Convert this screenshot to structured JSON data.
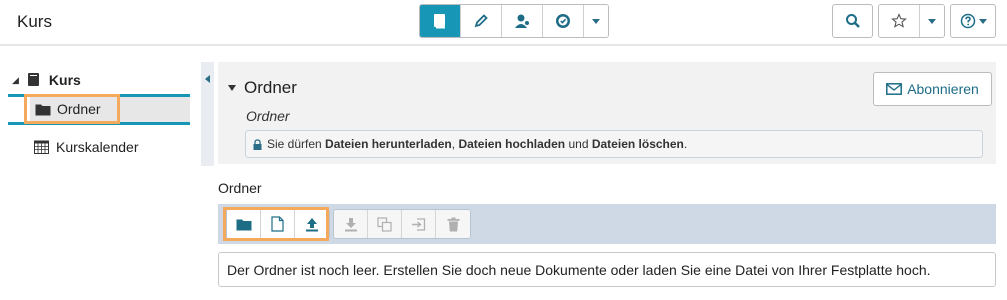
{
  "header": {
    "course_title": "Kurs",
    "tools": [
      {
        "name": "book-icon",
        "active": true
      },
      {
        "name": "pencil-icon",
        "active": false
      },
      {
        "name": "user-icon",
        "active": false
      },
      {
        "name": "badge-icon",
        "active": false
      },
      {
        "name": "chevron-down-icon",
        "active": false
      }
    ],
    "right_tools": [
      "search-icon",
      "star-icon",
      "help-icon"
    ]
  },
  "nav": {
    "root_label": "Kurs",
    "items": [
      {
        "label": "Ordner",
        "icon": "folder-icon",
        "selected": true
      },
      {
        "label": "Kurskalender",
        "icon": "calendar-icon",
        "selected": false
      }
    ]
  },
  "node": {
    "title": "Ordner",
    "subtitle": "Ordner",
    "subscribe_label": "Abonnieren",
    "rights": {
      "prefix": "Sie dürfen",
      "right1": "Dateien herunterladen",
      "sep1": ",",
      "right2": "Dateien hochladen",
      "and": "und",
      "right3": "Dateien löschen",
      "suffix": "."
    }
  },
  "folder": {
    "heading": "Ordner",
    "toolbar_enabled": [
      "new-folder-icon",
      "new-document-icon",
      "upload-icon"
    ],
    "toolbar_disabled": [
      "download-icon",
      "copy-icon",
      "move-icon",
      "trash-icon"
    ],
    "empty_message": "Der Ordner ist noch leer. Erstellen Sie doch neue Dokumente oder laden Sie eine Datei von Ihrer Festplatte hoch."
  },
  "colors": {
    "accent": "#1796b6",
    "icon_blue": "#1d6d87",
    "highlight_orange": "#f5a95c",
    "toolbar_bg": "#cfd9e6",
    "disabled_icon": "#b0b0b0"
  }
}
